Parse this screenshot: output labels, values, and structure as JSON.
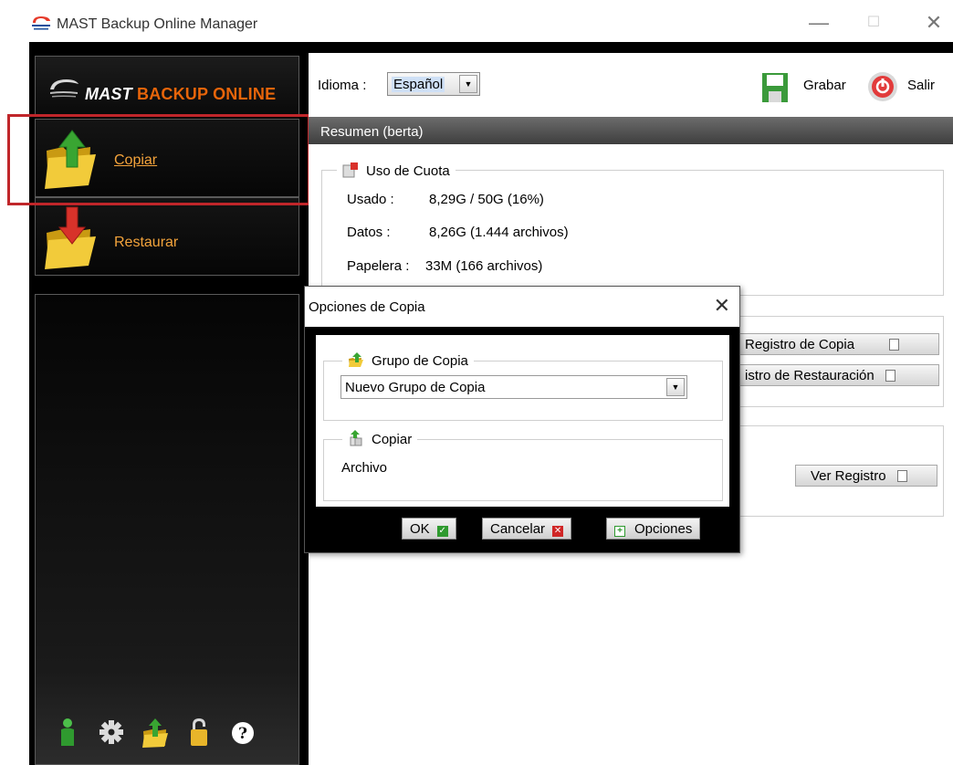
{
  "window": {
    "title": "MAST Backup Online  Manager",
    "min_glyph": "—",
    "max_glyph": "☐",
    "close_glyph": "✕"
  },
  "logo": {
    "part1": "MAST",
    "part2": "BACKUP ONLINE"
  },
  "sidebar": {
    "items": [
      {
        "label": "Copiar",
        "icon": "folder-upload-icon"
      },
      {
        "label": "Restaurar",
        "icon": "folder-download-icon"
      }
    ],
    "bottom_icons": [
      "user-icon",
      "gear-icon",
      "folder-transfer-icon",
      "lock-icon",
      "help-icon"
    ]
  },
  "toolbar": {
    "language_label": "Idioma :",
    "language_value": "Español",
    "save_label": "Grabar",
    "exit_label": "Salir"
  },
  "summary": {
    "header": "Resumen (berta)",
    "quota_title": "Uso de Cuota",
    "rows": [
      {
        "label": "Usado :",
        "value": "8,29G / 50G (16%)"
      },
      {
        "label": "Datos :",
        "value": "8,26G  (1.444 archivos)"
      },
      {
        "label": "Papelera :",
        "value": "33M  (166 archivos)"
      }
    ],
    "btn_backup_log": "Registro de Copia",
    "btn_restore_log": "istro de Restauración",
    "btn_view_log": "Ver Registro"
  },
  "dialog": {
    "title": "Opciones de Copia",
    "close_glyph": "✕",
    "group_title": "Grupo de Copia",
    "group_value": "Nuevo Grupo de Copia",
    "copy_title": "Copiar",
    "copy_item": "Archivo",
    "ok_label": "OK",
    "cancel_label": "Cancelar",
    "options_label": "Opciones"
  },
  "colors": {
    "accent_orange": "#f3a33b",
    "highlight_red": "#c0262a",
    "header_gray": "#4e4e4e"
  }
}
